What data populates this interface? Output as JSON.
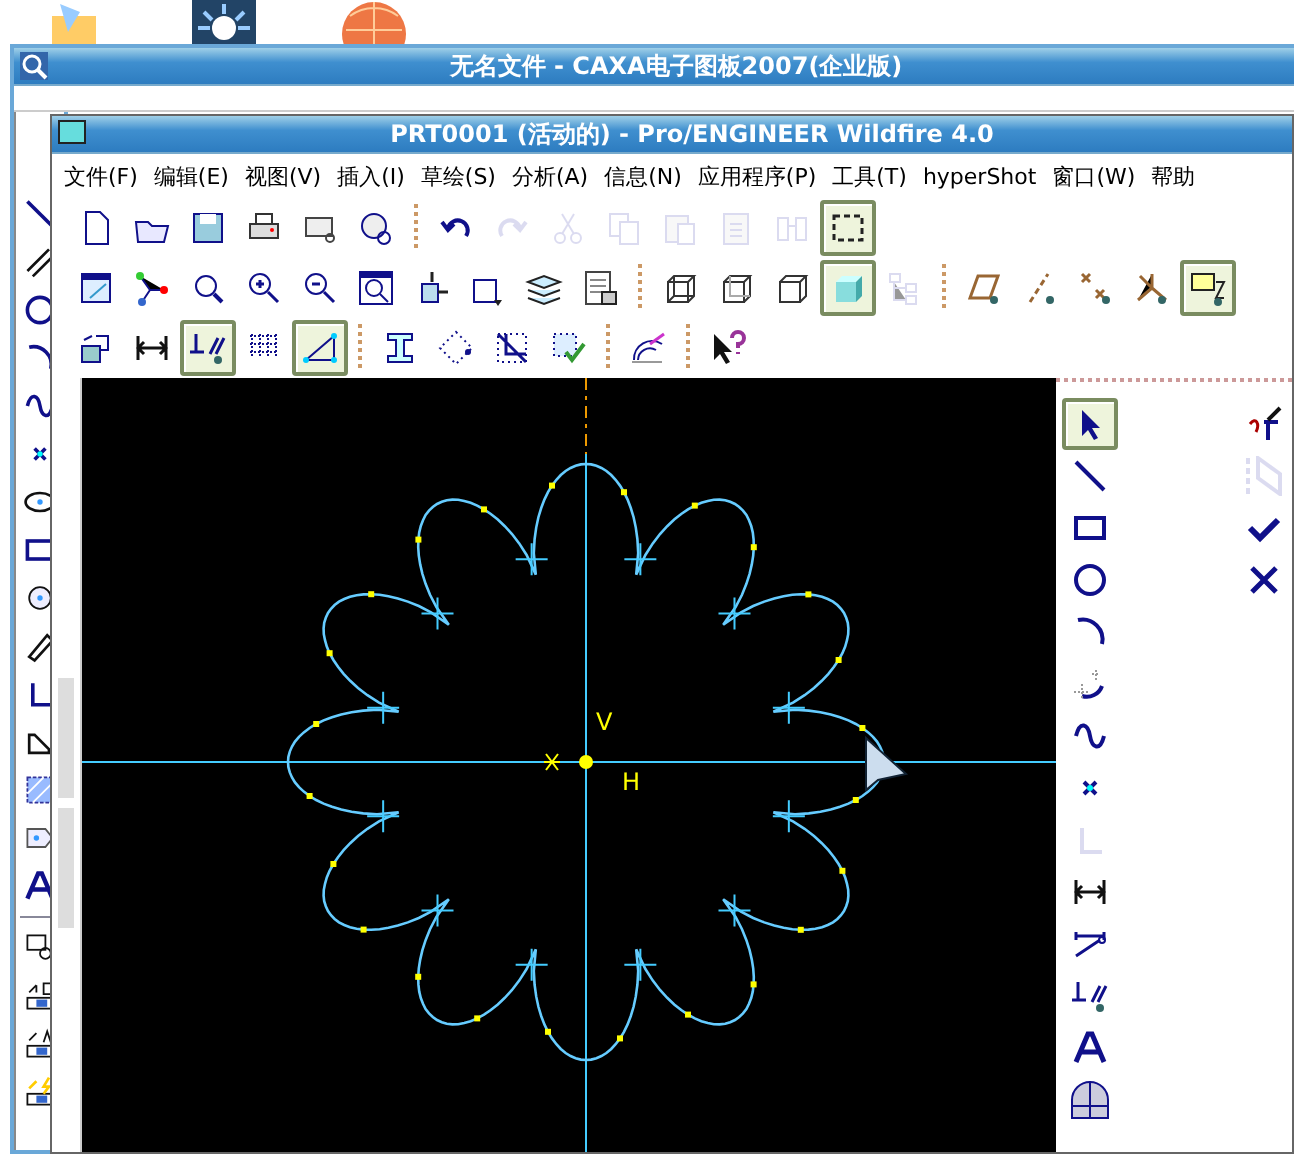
{
  "caxa_window": {
    "title": "无名文件 - CAXA电子图板2007(企业版)"
  },
  "proe_window": {
    "title": "PRT0001 (活动的) - Pro/ENGINEER Wildfire 4.0",
    "menu": [
      "文件(F)",
      "编辑(E)",
      "视图(V)",
      "插入(I)",
      "草绘(S)",
      "分析(A)",
      "信息(N)",
      "应用程序(P)",
      "工具(T)",
      "hyperShot",
      "窗口(W)",
      "帮助"
    ],
    "toolbars": [
      [
        {
          "kind": "new",
          "disabled": false,
          "pressed": false
        },
        {
          "kind": "open",
          "disabled": false,
          "pressed": false
        },
        {
          "kind": "save",
          "disabled": false,
          "pressed": false
        },
        {
          "kind": "print",
          "disabled": false,
          "pressed": false
        },
        {
          "kind": "mail",
          "disabled": false,
          "pressed": false
        },
        {
          "kind": "mail-link",
          "disabled": false,
          "pressed": false
        },
        {
          "kind": "separator"
        },
        {
          "kind": "undo",
          "disabled": false,
          "pressed": false
        },
        {
          "kind": "redo",
          "disabled": true,
          "pressed": false
        },
        {
          "kind": "cut",
          "disabled": true,
          "pressed": false
        },
        {
          "kind": "copy",
          "disabled": true,
          "pressed": false
        },
        {
          "kind": "paste",
          "disabled": true,
          "pressed": false
        },
        {
          "kind": "paste-special",
          "disabled": true,
          "pressed": false
        },
        {
          "kind": "binoculars",
          "disabled": true,
          "pressed": false
        },
        {
          "kind": "select-box",
          "disabled": false,
          "pressed": true
        }
      ],
      [
        {
          "kind": "sketch-setup",
          "disabled": false,
          "pressed": false
        },
        {
          "kind": "nodes",
          "disabled": false,
          "pressed": false
        },
        {
          "kind": "refit",
          "disabled": false,
          "pressed": false
        },
        {
          "kind": "zoom-in",
          "disabled": false,
          "pressed": false
        },
        {
          "kind": "zoom-out",
          "disabled": false,
          "pressed": false
        },
        {
          "kind": "zoom-window",
          "disabled": false,
          "pressed": false
        },
        {
          "kind": "orient",
          "disabled": false,
          "pressed": false
        },
        {
          "kind": "views",
          "disabled": false,
          "pressed": false
        },
        {
          "kind": "layers",
          "disabled": false,
          "pressed": false
        },
        {
          "kind": "view-manager",
          "disabled": false,
          "pressed": false
        },
        {
          "kind": "separator"
        },
        {
          "kind": "wireframe",
          "disabled": false,
          "pressed": false
        },
        {
          "kind": "hidden-line",
          "disabled": false,
          "pressed": false
        },
        {
          "kind": "no-hidden",
          "disabled": false,
          "pressed": false
        },
        {
          "kind": "shaded",
          "disabled": false,
          "pressed": true
        },
        {
          "kind": "tree",
          "disabled": true,
          "pressed": false
        },
        {
          "kind": "separator"
        },
        {
          "kind": "plane",
          "disabled": false,
          "pressed": false
        },
        {
          "kind": "axis",
          "disabled": false,
          "pressed": false
        },
        {
          "kind": "points",
          "disabled": false,
          "pressed": false
        },
        {
          "kind": "csys",
          "disabled": false,
          "pressed": false
        },
        {
          "kind": "csys-box",
          "disabled": false,
          "pressed": true
        }
      ],
      [
        {
          "kind": "sketch-place",
          "disabled": false,
          "pressed": false
        },
        {
          "kind": "dimension",
          "disabled": false,
          "pressed": false
        },
        {
          "kind": "constraints",
          "disabled": false,
          "pressed": true
        },
        {
          "kind": "grid",
          "disabled": false,
          "pressed": false
        },
        {
          "kind": "vertices",
          "disabled": false,
          "pressed": true
        },
        {
          "kind": "separator"
        },
        {
          "kind": "beam",
          "disabled": false,
          "pressed": false
        },
        {
          "kind": "diamond-dots",
          "disabled": false,
          "pressed": false
        },
        {
          "kind": "overlap",
          "disabled": false,
          "pressed": false
        },
        {
          "kind": "check-box",
          "disabled": false,
          "pressed": false
        },
        {
          "kind": "separator"
        },
        {
          "kind": "protractor",
          "disabled": false,
          "pressed": false
        },
        {
          "kind": "separator"
        },
        {
          "kind": "help-pointer",
          "disabled": false,
          "pressed": false
        }
      ]
    ],
    "sketch": {
      "labels": [
        "V",
        "H"
      ]
    },
    "palette": [
      [
        {
          "kind": "pointer",
          "disabled": false,
          "pressed": true
        },
        {
          "kind": "line",
          "disabled": false,
          "pressed": false
        },
        {
          "kind": "rectangle",
          "disabled": false,
          "pressed": false
        },
        {
          "kind": "circle",
          "disabled": false,
          "pressed": false
        },
        {
          "kind": "arc",
          "disabled": false,
          "pressed": false
        },
        {
          "kind": "fillet",
          "disabled": false,
          "pressed": false
        },
        {
          "kind": "spline",
          "disabled": false,
          "pressed": false
        },
        {
          "kind": "point",
          "disabled": false,
          "pressed": false
        },
        {
          "kind": "corner",
          "disabled": true,
          "pressed": false
        },
        {
          "kind": "dimension",
          "disabled": false,
          "pressed": false
        },
        {
          "kind": "modify",
          "disabled": false,
          "pressed": false
        },
        {
          "kind": "constraints",
          "disabled": false,
          "pressed": false
        },
        {
          "kind": "text",
          "disabled": false,
          "pressed": false
        },
        {
          "kind": "palette",
          "disabled": false,
          "pressed": false
        }
      ],
      [
        {
          "kind": "trim",
          "disabled": false,
          "pressed": false
        },
        {
          "kind": "mirror",
          "disabled": true,
          "pressed": false
        },
        {
          "kind": "check",
          "disabled": false,
          "pressed": false
        },
        {
          "kind": "cross",
          "disabled": false,
          "pressed": false
        }
      ]
    ]
  }
}
